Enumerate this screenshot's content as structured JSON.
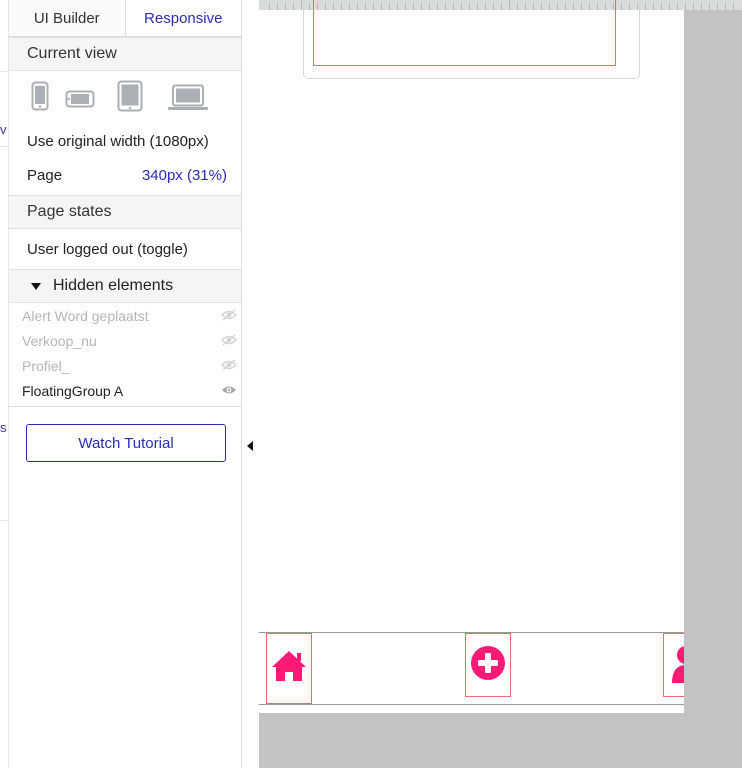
{
  "tabs": {
    "builder": "UI Builder",
    "responsive": "Responsive"
  },
  "left_strip": {
    "fragment1": "v",
    "fragment2": "s"
  },
  "current_view": {
    "heading": "Current view",
    "devices": [
      "phone-portrait-icon",
      "phone-landscape-icon",
      "tablet-icon",
      "laptop-icon"
    ],
    "original_width_label": "Use original width (1080px)",
    "page_label": "Page",
    "page_value": "340px (31%)"
  },
  "page_states": {
    "heading": "Page states",
    "item": "User logged out (toggle)"
  },
  "hidden_elements": {
    "heading": "Hidden elements",
    "items": [
      {
        "label": "Alert Word geplaatst",
        "visible": false
      },
      {
        "label": "Verkoop_nu",
        "visible": false
      },
      {
        "label": "Profiel_",
        "visible": false
      },
      {
        "label": "FloatingGroup A",
        "visible": true
      }
    ]
  },
  "tutorial_button": "Watch Tutorial",
  "colors": {
    "accent": "#2b2bb8",
    "brand_pink": "#ff1a75",
    "selection_red": "#ee6a6a"
  },
  "canvas": {
    "bottom_nav_icons": [
      "home-icon",
      "add-circle-icon",
      "user-icon"
    ]
  }
}
